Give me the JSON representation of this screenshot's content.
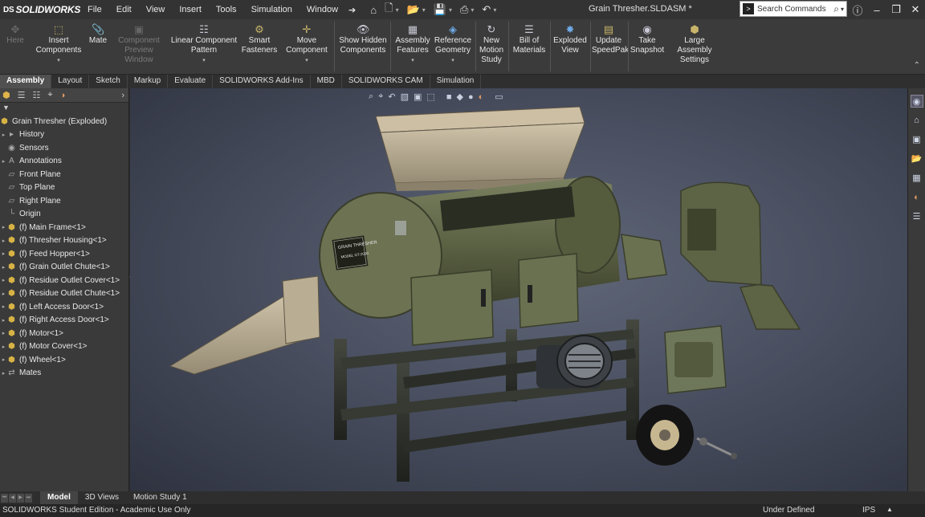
{
  "app": {
    "logo_text": "SOLIDWORKS",
    "logo_mark": "DS",
    "document_title": "Grain Thresher.SLDASM *"
  },
  "menus": [
    "File",
    "Edit",
    "View",
    "Insert",
    "Tools",
    "Simulation",
    "Window"
  ],
  "search": {
    "placeholder": "Search Commands"
  },
  "ribbon": {
    "buttons": [
      {
        "id": "here",
        "label": "Here",
        "icon": "here-icon",
        "disabled": true
      },
      {
        "id": "insert-components",
        "label": "Insert Components",
        "icon": "insert-components-icon",
        "dropdown": true
      },
      {
        "id": "mate",
        "label": "Mate",
        "icon": "mate-icon"
      },
      {
        "id": "component-preview-window",
        "label": "Component Preview Window",
        "icon": "preview-window-icon",
        "disabled": true
      },
      {
        "id": "linear-component-pattern",
        "label": "Linear Component Pattern",
        "icon": "linear-pattern-icon",
        "dropdown": true
      },
      {
        "id": "smart-fasteners",
        "label": "Smart Fasteners",
        "icon": "smart-fasteners-icon"
      },
      {
        "id": "move-component",
        "label": "Move Component",
        "icon": "move-component-icon",
        "dropdown": true
      },
      {
        "id": "show-hidden-components",
        "label": "Show Hidden Components",
        "icon": "show-hidden-icon"
      },
      {
        "id": "assembly-features",
        "label": "Assembly Features",
        "icon": "assembly-features-icon",
        "dropdown": true
      },
      {
        "id": "reference-geometry",
        "label": "Reference Geometry",
        "icon": "reference-geometry-icon",
        "dropdown": true
      },
      {
        "id": "new-motion-study",
        "label": "New Motion Study",
        "icon": "motion-study-icon"
      },
      {
        "id": "bill-of-materials",
        "label": "Bill of Materials",
        "icon": "bom-icon"
      },
      {
        "id": "exploded-view",
        "label": "Exploded View",
        "icon": "exploded-view-icon"
      },
      {
        "id": "update-speedpak",
        "label": "Update SpeedPak",
        "icon": "speedpak-icon"
      },
      {
        "id": "take-snapshot",
        "label": "Take Snapshot",
        "icon": "snapshot-icon"
      },
      {
        "id": "large-assembly-settings",
        "label": "Large Assembly Settings",
        "icon": "large-assembly-icon"
      }
    ]
  },
  "tabs": [
    "Assembly",
    "Layout",
    "Sketch",
    "Markup",
    "Evaluate",
    "SOLIDWORKS Add-Ins",
    "MBD",
    "SOLIDWORKS CAM",
    "Simulation"
  ],
  "active_tab": "Assembly",
  "feature_tree": {
    "root": "Grain Thresher  (Exploded)",
    "items": [
      {
        "label": "History",
        "icon": "history-icon",
        "expandable": true
      },
      {
        "label": "Sensors",
        "icon": "sensors-icon",
        "expandable": false
      },
      {
        "label": "Annotations",
        "icon": "annotations-icon",
        "expandable": true
      },
      {
        "label": "Front Plane",
        "icon": "plane-icon",
        "expandable": false
      },
      {
        "label": "Top Plane",
        "icon": "plane-icon",
        "expandable": false
      },
      {
        "label": "Right Plane",
        "icon": "plane-icon",
        "expandable": false
      },
      {
        "label": "Origin",
        "icon": "origin-icon",
        "expandable": false
      },
      {
        "label": "(f) Main Frame<1>",
        "icon": "part-icon",
        "expandable": true
      },
      {
        "label": "(f) Thresher Housing<1>",
        "icon": "part-icon",
        "expandable": true
      },
      {
        "label": "(f) Feed Hopper<1>",
        "icon": "part-icon",
        "expandable": true
      },
      {
        "label": "(f) Grain Outlet Chute<1>",
        "icon": "part-icon",
        "expandable": true
      },
      {
        "label": "(f) Residue Outlet Cover<1>",
        "icon": "part-icon",
        "expandable": true
      },
      {
        "label": "(f) Residue Outlet Chute<1>",
        "icon": "part-icon",
        "expandable": true
      },
      {
        "label": "(f) Left Access Door<1>",
        "icon": "part-icon",
        "expandable": true
      },
      {
        "label": "(f) Right Access Door<1>",
        "icon": "part-icon",
        "expandable": true
      },
      {
        "label": "(f) Motor<1>",
        "icon": "part-icon",
        "expandable": true
      },
      {
        "label": "(f) Motor Cover<1>",
        "icon": "part-icon",
        "expandable": true
      },
      {
        "label": "(f) Wheel<1>",
        "icon": "part-icon",
        "expandable": true
      },
      {
        "label": "Mates",
        "icon": "mates-icon",
        "expandable": true
      }
    ]
  },
  "model": {
    "housing_label_line1": "GRAIN THRESHER",
    "housing_label_line2": "MODEL GT-2000",
    "body_color": "#5b6143",
    "chute_color": "#b7ab92",
    "frame_color": "#2d302b"
  },
  "bottom_tabs": [
    "Model",
    "3D Views",
    "Motion Study 1"
  ],
  "active_bottom_tab": "Model",
  "status": {
    "edition": "SOLIDWORKS Student Edition - Academic Use Only",
    "state": "Under Defined",
    "units": "IPS"
  }
}
